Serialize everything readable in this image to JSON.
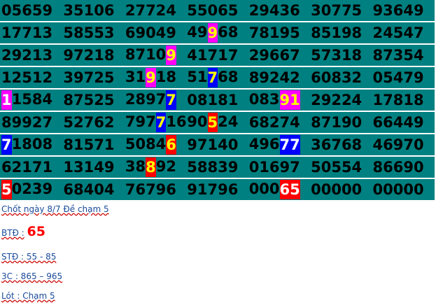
{
  "rows": [
    [
      [
        "05659"
      ],
      [
        "35106"
      ],
      [
        "27724"
      ],
      [
        "55065"
      ],
      [
        "29436"
      ],
      [
        "30775"
      ],
      [
        "93649"
      ]
    ],
    [
      [
        "17713"
      ],
      [
        "58553"
      ],
      [
        "69049"
      ],
      [
        "49",
        {
          "t": "9",
          "c": "magenta"
        },
        "68"
      ],
      [
        "78195"
      ],
      [
        "85198"
      ],
      [
        "24547"
      ]
    ],
    [
      [
        "29213"
      ],
      [
        "97218"
      ],
      [
        "8710",
        {
          "t": "9",
          "c": "magenta"
        }
      ],
      [
        "41717"
      ],
      [
        "29667"
      ],
      [
        "57318"
      ],
      [
        "87354"
      ]
    ],
    [
      [
        "12512"
      ],
      [
        "39725"
      ],
      [
        "31",
        {
          "t": "9",
          "c": "magenta"
        },
        "18"
      ],
      [
        "51",
        {
          "t": "7",
          "c": "blue"
        },
        "68"
      ],
      [
        "89242"
      ],
      [
        "60832"
      ],
      [
        "05479"
      ]
    ],
    [
      [
        {
          "t": "1",
          "c": "magenta",
          "w": true
        },
        "1584"
      ],
      [
        "87525"
      ],
      [
        "2897",
        {
          "t": "7",
          "c": "blue"
        }
      ],
      [
        "08181"
      ],
      [
        "083",
        {
          "t": "91",
          "c": "magenta"
        }
      ],
      [
        "29224"
      ],
      [
        "17818"
      ]
    ],
    [
      [
        "89927"
      ],
      [
        "52762"
      ],
      [
        "797",
        {
          "t": "7",
          "c": "blue"
        },
        "16"
      ],
      [
        "90",
        {
          "t": "5",
          "c": "red"
        },
        "24"
      ],
      [
        "68274"
      ],
      [
        "87190"
      ],
      [
        "66449"
      ]
    ],
    [
      [
        {
          "t": "7",
          "c": "blue",
          "w": true
        },
        "1808"
      ],
      [
        "81571"
      ],
      [
        "5084",
        {
          "t": "6",
          "c": "red"
        }
      ],
      [
        "97140"
      ],
      [
        "496",
        {
          "t": "77",
          "c": "blue",
          "w": true
        }
      ],
      [
        "36768"
      ],
      [
        "46970"
      ]
    ],
    [
      [
        "62171"
      ],
      [
        "13149"
      ],
      [
        "38",
        {
          "t": "8",
          "c": "red"
        },
        "92"
      ],
      [
        "58839"
      ],
      [
        "01697"
      ],
      [
        "50554"
      ],
      [
        "86690"
      ]
    ],
    [
      [
        {
          "t": "5",
          "c": "red",
          "w": true
        },
        "0239"
      ],
      [
        "68404"
      ],
      [
        "76796"
      ],
      [
        "91796"
      ],
      [
        "000",
        {
          "t": "65",
          "c": "red",
          "w": true
        }
      ],
      [
        "00000"
      ],
      [
        "00000"
      ]
    ]
  ],
  "notes": {
    "line1": "Chốt ngày 8/7 Đề chạm 5",
    "btd_label": "BTĐ :",
    "btd_value": "65",
    "std": "STĐ : 55 - 85",
    "three_c": "3C : 865  – 965",
    "lot": "Lót : Chạm 5"
  },
  "colors": {
    "row_bg": "#008080",
    "highlight_magenta": "#ff00ff",
    "highlight_blue": "#0000ff",
    "highlight_red": "#ff0000",
    "highlight_text": "#ffff00",
    "note_text": "#1a4a9a"
  }
}
